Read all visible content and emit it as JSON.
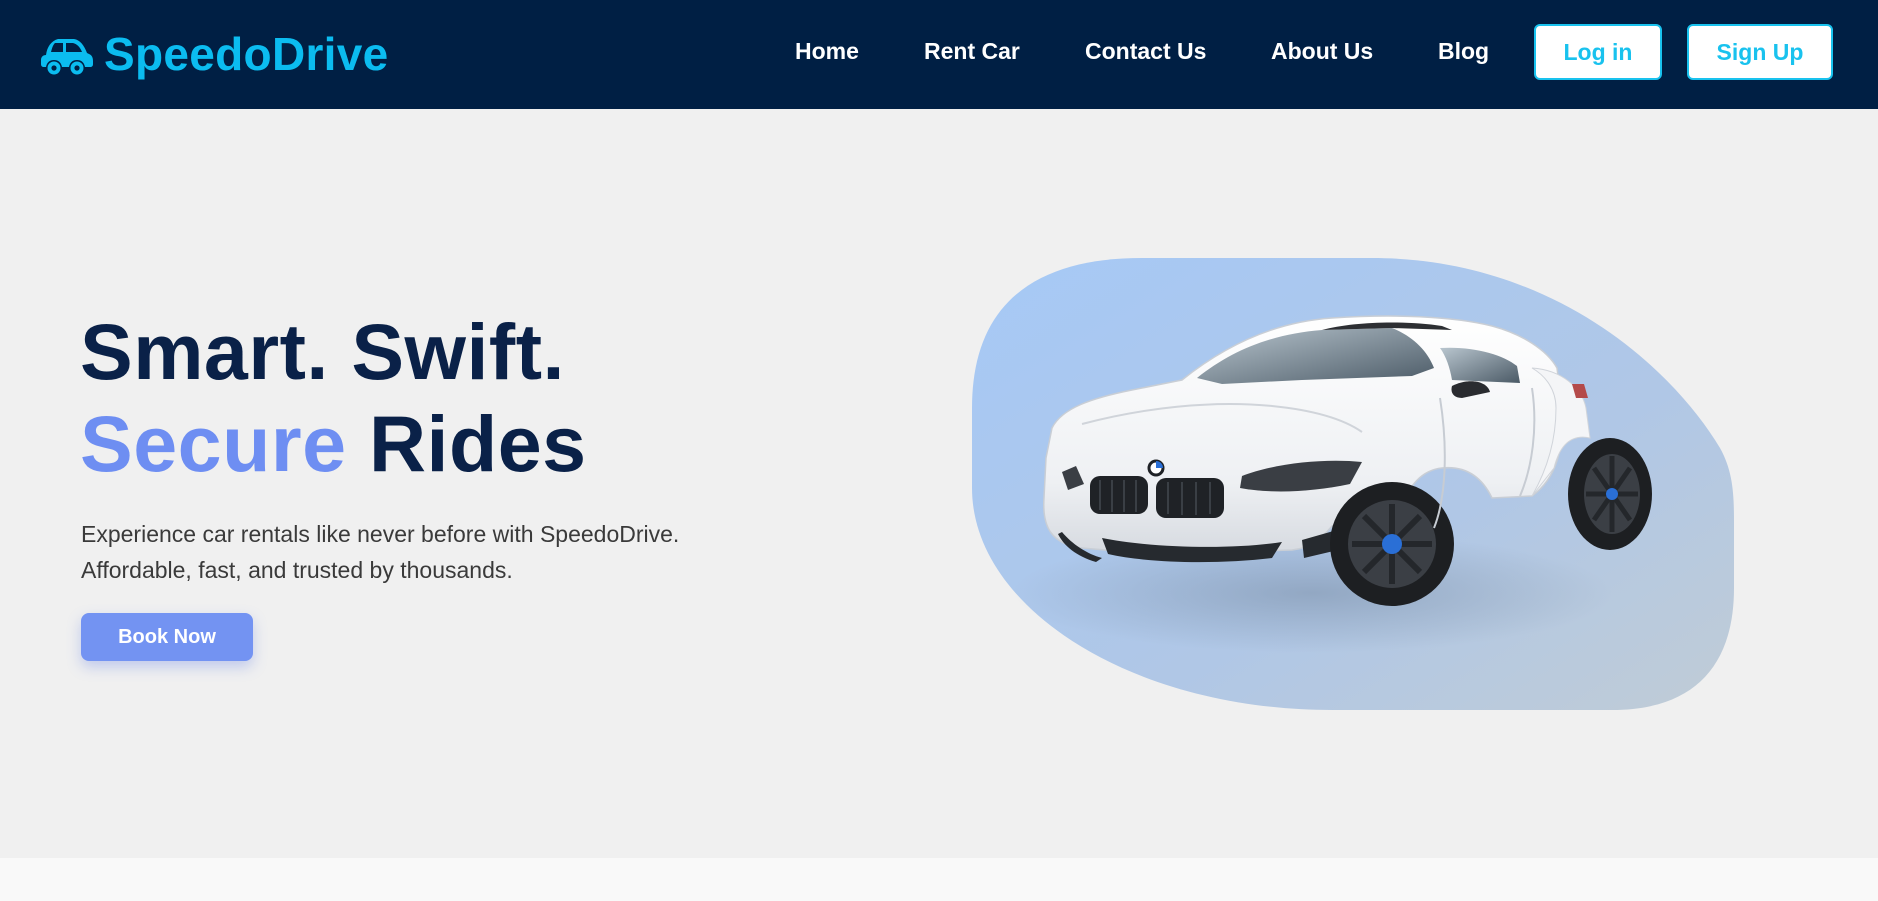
{
  "brand": {
    "name": "SpeedoDrive",
    "icon": "car-icon",
    "color": "#0bbcf0"
  },
  "nav": {
    "links": [
      "Home",
      "Rent Car",
      "Contact Us",
      "About Us",
      "Blog"
    ],
    "login_label": "Log in",
    "signup_label": "Sign Up"
  },
  "hero": {
    "title_line1": "Smart. Swift.",
    "title_accent": "Secure",
    "title_rest": " Rides",
    "description_line1": "Experience car rentals like never before with SpeedoDrive.",
    "description_line2": "Affordable, fast, and trusted by thousands.",
    "cta_label": "Book Now",
    "image": "white-sports-car"
  },
  "colors": {
    "navbar": "#001f44",
    "heading": "#0a2148",
    "accent": "#6e8ef2",
    "button": "#7393f2",
    "page_bg": "#f0f0f0"
  }
}
